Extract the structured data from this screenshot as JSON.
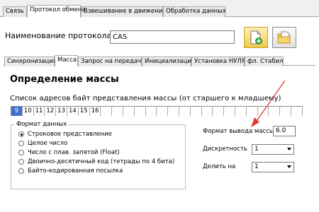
{
  "main_tabs": [
    {
      "label": "Связь"
    },
    {
      "label": "Протокол обмена"
    },
    {
      "label": "Взвешивание в движении"
    },
    {
      "label": "Обработка данных"
    }
  ],
  "protocol": {
    "name_label": "Наименование протокола",
    "name_value": "CAS"
  },
  "toolbar": {
    "buttons": [
      {
        "icon": "document-add-icon"
      },
      {
        "icon": "folder-open-icon"
      }
    ]
  },
  "sub_tabs": [
    {
      "label": "Синхронизация"
    },
    {
      "label": "Масса"
    },
    {
      "label": "Запрос на передачу"
    },
    {
      "label": "Инициализация"
    },
    {
      "label": "Установка НУЛЯ"
    },
    {
      "label": "фл. Стабил"
    }
  ],
  "mass": {
    "title": "Определение массы",
    "address_label": "Список адресов байт представления массы (от старшего к младшему)",
    "address_cells": [
      "9",
      "10",
      "11",
      "12",
      "13",
      "14",
      "15",
      "16",
      "",
      "",
      "",
      "",
      "",
      "",
      "",
      "",
      "",
      "",
      "",
      "",
      "",
      "",
      "",
      "",
      "",
      ""
    ],
    "selected_cell": "9"
  },
  "data_format": {
    "legend": "Формат данных",
    "options": [
      {
        "label": "Строковое представление",
        "checked": true
      },
      {
        "label": "Целое число",
        "checked": false
      },
      {
        "label": "Число с плав. запятой (Float)",
        "checked": false
      },
      {
        "label": "Двоично-десятичный код (тетрады по 4 бита)",
        "checked": false
      },
      {
        "label": "Байто-кодированная посылка",
        "checked": false
      }
    ]
  },
  "output": {
    "format_label": "Формат вывода массы",
    "format_value": "6.0",
    "discreteness_label": "Дискретность",
    "discreteness_value": "1",
    "divide_label": "Делить на",
    "divide_value": "1"
  },
  "colors": {
    "selection": "#3f6fcf",
    "annotation_arrow": "#e53935"
  }
}
